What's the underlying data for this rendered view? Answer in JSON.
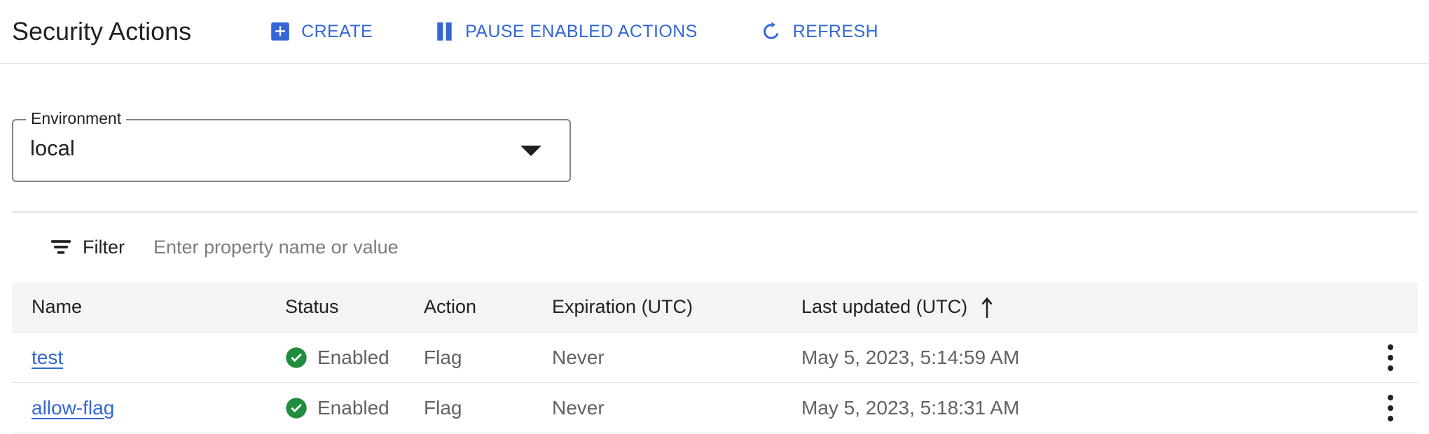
{
  "header": {
    "title": "Security Actions",
    "buttons": [
      {
        "label": "CREATE",
        "icon": "plus-box-icon"
      },
      {
        "label": "PAUSE ENABLED ACTIONS",
        "icon": "pause-icon"
      },
      {
        "label": "REFRESH",
        "icon": "refresh-icon"
      }
    ]
  },
  "environment": {
    "legend": "Environment",
    "value": "local",
    "arrow_icon": "chevron-down-icon"
  },
  "filter": {
    "icon": "filter-icon",
    "label": "Filter",
    "value": "",
    "placeholder": "Enter property name or value"
  },
  "table": {
    "columns": [
      {
        "key": "name",
        "label": "Name"
      },
      {
        "key": "status",
        "label": "Status"
      },
      {
        "key": "action",
        "label": "Action"
      },
      {
        "key": "expiration",
        "label": "Expiration (UTC)"
      },
      {
        "key": "last_updated",
        "label": "Last updated (UTC)"
      }
    ],
    "sort": {
      "column": "Last updated (UTC)",
      "direction": "ascending",
      "icon": "arrow-up-icon"
    },
    "rows": [
      {
        "name": "test",
        "status": "Enabled",
        "status_icon": "check-circle-icon",
        "action": "Flag",
        "expiration": "Never",
        "last_updated": "May 5, 2023, 5:14:59 AM",
        "menu_icon": "more-vert-icon"
      },
      {
        "name": "allow-flag",
        "status": "Enabled",
        "status_icon": "check-circle-icon",
        "action": "Flag",
        "expiration": "Never",
        "last_updated": "May 5, 2023, 5:18:31 AM",
        "menu_icon": "more-vert-icon"
      }
    ]
  },
  "colors": {
    "accent_blue": "#3367d6",
    "status_green": "#1e8e3e",
    "text_primary": "#202124",
    "text_secondary": "#5f6368",
    "divider": "#e3e3e3",
    "header_bg": "#f4f4f4",
    "field_border": "#80868b"
  }
}
